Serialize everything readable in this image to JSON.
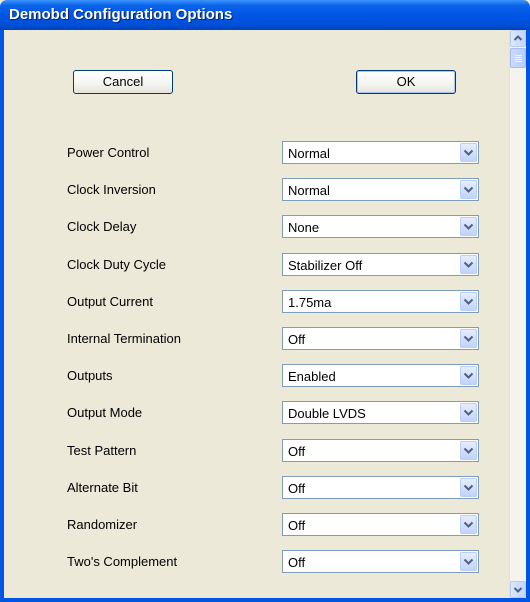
{
  "window": {
    "title": "Demobd Configuration Options"
  },
  "buttons": {
    "cancel_label": "Cancel",
    "ok_label": "OK"
  },
  "options": [
    {
      "label": "Power Control",
      "value": "Normal"
    },
    {
      "label": "Clock Inversion",
      "value": "Normal"
    },
    {
      "label": "Clock Delay",
      "value": "None"
    },
    {
      "label": "Clock Duty Cycle",
      "value": "Stabilizer Off"
    },
    {
      "label": "Output Current",
      "value": "1.75ma"
    },
    {
      "label": "Internal Termination",
      "value": "Off"
    },
    {
      "label": "Outputs",
      "value": "Enabled"
    },
    {
      "label": "Output Mode",
      "value": "Double LVDS"
    },
    {
      "label": "Test Pattern",
      "value": "Off"
    },
    {
      "label": "Alternate Bit",
      "value": "Off"
    },
    {
      "label": "Randomizer",
      "value": "Off"
    },
    {
      "label": "Two's Complement",
      "value": "Off"
    }
  ],
  "icons": {
    "dropdown": "chevron-down-icon",
    "scroll_up": "scroll-up-arrow-icon",
    "scroll_down": "scroll-down-arrow-icon"
  },
  "colors": {
    "titlebar": "#0055e5",
    "dialog_background": "#ece9d8",
    "field_border": "#7f9db9"
  }
}
